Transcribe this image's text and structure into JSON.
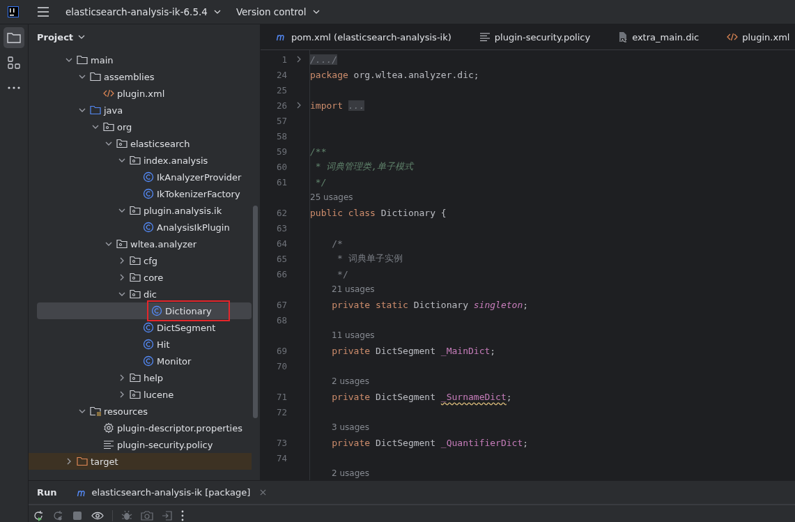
{
  "title_bar": {
    "project": "elasticsearch-analysis-ik-6.5.4",
    "vcs": "Version control"
  },
  "project_panel": {
    "title": "Project"
  },
  "tree": [
    {
      "name": "main",
      "kind": "folder",
      "expanded": true,
      "selected": false,
      "outlined": false,
      "children": [
        {
          "name": "assemblies",
          "kind": "folder",
          "expanded": true,
          "selected": false,
          "outlined": false,
          "children": [
            {
              "name": "plugin.xml",
              "kind": "xml",
              "selected": false,
              "outlined": false
            }
          ]
        },
        {
          "name": "java",
          "kind": "source-folder",
          "expanded": true,
          "selected": false,
          "outlined": false,
          "children": [
            {
              "name": "org",
              "kind": "package",
              "expanded": true,
              "selected": false,
              "outlined": false,
              "children": [
                {
                  "name": "elasticsearch",
                  "kind": "package",
                  "expanded": true,
                  "selected": false,
                  "outlined": false,
                  "children": [
                    {
                      "name": "index.analysis",
                      "kind": "package",
                      "expanded": true,
                      "selected": false,
                      "outlined": false,
                      "children": [
                        {
                          "name": "IkAnalyzerProvider",
                          "kind": "class",
                          "selected": false,
                          "outlined": false
                        },
                        {
                          "name": "IkTokenizerFactory",
                          "kind": "class",
                          "selected": false,
                          "outlined": false
                        }
                      ]
                    },
                    {
                      "name": "plugin.analysis.ik",
                      "kind": "package",
                      "expanded": true,
                      "selected": false,
                      "outlined": false,
                      "children": [
                        {
                          "name": "AnalysisIkPlugin",
                          "kind": "class",
                          "selected": false,
                          "outlined": false
                        }
                      ]
                    }
                  ]
                },
                {
                  "name": "wltea.analyzer",
                  "kind": "package",
                  "expanded": true,
                  "selected": false,
                  "outlined": false,
                  "children": [
                    {
                      "name": "cfg",
                      "kind": "package",
                      "expanded": false,
                      "selected": false,
                      "outlined": false
                    },
                    {
                      "name": "core",
                      "kind": "package",
                      "expanded": false,
                      "selected": false,
                      "outlined": false
                    },
                    {
                      "name": "dic",
                      "kind": "package",
                      "expanded": true,
                      "selected": false,
                      "outlined": false,
                      "children": [
                        {
                          "name": "Dictionary",
                          "kind": "class",
                          "selected": true,
                          "outlined": true
                        },
                        {
                          "name": "DictSegment",
                          "kind": "class",
                          "selected": false,
                          "outlined": false
                        },
                        {
                          "name": "Hit",
                          "kind": "class",
                          "selected": false,
                          "outlined": false
                        },
                        {
                          "name": "Monitor",
                          "kind": "class",
                          "selected": false,
                          "outlined": false
                        }
                      ]
                    },
                    {
                      "name": "help",
                      "kind": "package",
                      "expanded": false,
                      "selected": false,
                      "outlined": false
                    },
                    {
                      "name": "lucene",
                      "kind": "package",
                      "expanded": false,
                      "selected": false,
                      "outlined": false
                    }
                  ]
                }
              ]
            }
          ]
        },
        {
          "name": "resources",
          "kind": "resources-folder",
          "expanded": true,
          "selected": false,
          "outlined": false,
          "children": [
            {
              "name": "plugin-descriptor.properties",
              "kind": "properties",
              "selected": false,
              "outlined": false
            },
            {
              "name": "plugin-security.policy",
              "kind": "policy",
              "selected": false,
              "outlined": false
            }
          ]
        }
      ]
    },
    {
      "name": "target",
      "kind": "excluded-folder",
      "expanded": false,
      "selected": false,
      "outlined": false
    }
  ],
  "tabs": [
    {
      "label": "pom.xml (elasticsearch-analysis-ik)",
      "kind": "maven"
    },
    {
      "label": "plugin-security.policy",
      "kind": "policy"
    },
    {
      "label": "extra_main.dic",
      "kind": "dic"
    },
    {
      "label": "plugin.xml",
      "kind": "xml"
    }
  ],
  "code": [
    {
      "kind": "line",
      "number": "1",
      "fold": true,
      "indent": false,
      "tokens": [
        {
          "kind": "folded",
          "text": "/.../"
        }
      ]
    },
    {
      "kind": "line",
      "number": "24",
      "fold": false,
      "indent": false,
      "tokens": [
        {
          "kind": "keyword",
          "text": "package"
        },
        {
          "kind": "plain",
          "text": " org.wltea.analyzer.dic;"
        }
      ]
    },
    {
      "kind": "line",
      "number": "25",
      "fold": false
    },
    {
      "kind": "line",
      "number": "26",
      "fold": true,
      "indent": false,
      "tokens": [
        {
          "kind": "keyword",
          "text": "import"
        },
        {
          "kind": "folded",
          "text": "..."
        }
      ]
    },
    {
      "kind": "line",
      "number": "57",
      "fold": false
    },
    {
      "kind": "line",
      "number": "58",
      "fold": false
    },
    {
      "kind": "line",
      "number": "59",
      "fold": false,
      "indent": false,
      "tokens": [
        {
          "kind": "doc",
          "text": "/**"
        }
      ]
    },
    {
      "kind": "line",
      "number": "60",
      "fold": false,
      "indent": false,
      "tokens": [
        {
          "kind": "doc",
          "text": " * 词典管理类,单子模式"
        }
      ]
    },
    {
      "kind": "line",
      "number": "61",
      "fold": false,
      "indent": false,
      "tokens": [
        {
          "kind": "doc",
          "text": " */"
        }
      ]
    },
    {
      "kind": "hint",
      "text": "25 usages",
      "indent": false
    },
    {
      "kind": "line",
      "number": "62",
      "fold": false,
      "indent": false,
      "tokens": [
        {
          "kind": "keyword",
          "text": "public class"
        },
        {
          "kind": "plain",
          "text": " Dictionary {"
        }
      ]
    },
    {
      "kind": "line",
      "number": "63",
      "fold": false
    },
    {
      "kind": "line",
      "number": "64",
      "fold": false,
      "indent": true,
      "tokens": [
        {
          "kind": "comment",
          "text": "/*"
        }
      ]
    },
    {
      "kind": "line",
      "number": "65",
      "fold": false,
      "indent": true,
      "tokens": [
        {
          "kind": "comment",
          "text": " * 词典单子实例"
        }
      ]
    },
    {
      "kind": "line",
      "number": "66",
      "fold": false,
      "indent": true,
      "tokens": [
        {
          "kind": "comment",
          "text": " */"
        }
      ]
    },
    {
      "kind": "hint",
      "text": "21 usages",
      "indent": true
    },
    {
      "kind": "line",
      "number": "67",
      "fold": false,
      "indent": true,
      "tokens": [
        {
          "kind": "keyword",
          "text": "private static"
        },
        {
          "kind": "plain",
          "text": " Dictionary "
        },
        {
          "kind": "static-field",
          "text": "singleton"
        },
        {
          "kind": "plain",
          "text": ";"
        }
      ]
    },
    {
      "kind": "line",
      "number": "68",
      "fold": false
    },
    {
      "kind": "hint",
      "text": "11 usages",
      "indent": true
    },
    {
      "kind": "line",
      "number": "69",
      "fold": false,
      "indent": true,
      "tokens": [
        {
          "kind": "keyword",
          "text": "private"
        },
        {
          "kind": "plain",
          "text": " DictSegment "
        },
        {
          "kind": "field",
          "text": "_MainDict"
        },
        {
          "kind": "plain",
          "text": ";"
        }
      ]
    },
    {
      "kind": "line",
      "number": "70",
      "fold": false
    },
    {
      "kind": "hint",
      "text": "2 usages",
      "indent": true
    },
    {
      "kind": "line",
      "number": "71",
      "fold": false,
      "indent": true,
      "tokens": [
        {
          "kind": "keyword",
          "text": "private"
        },
        {
          "kind": "plain",
          "text": " DictSegment "
        },
        {
          "kind": "field-warning",
          "text": "_SurnameDict"
        },
        {
          "kind": "plain",
          "text": ";"
        }
      ]
    },
    {
      "kind": "line",
      "number": "72",
      "fold": false
    },
    {
      "kind": "hint",
      "text": "3 usages",
      "indent": true
    },
    {
      "kind": "line",
      "number": "73",
      "fold": false,
      "indent": true,
      "tokens": [
        {
          "kind": "keyword",
          "text": "private"
        },
        {
          "kind": "plain",
          "text": " DictSegment "
        },
        {
          "kind": "field",
          "text": "_QuantifierDict"
        },
        {
          "kind": "plain",
          "text": ";"
        }
      ]
    },
    {
      "kind": "line",
      "number": "74",
      "fold": false
    },
    {
      "kind": "hint",
      "text": "2 usages",
      "indent": true
    }
  ],
  "run_panel": {
    "title": "Run",
    "tab": "elasticsearch-analysis-ik [package]"
  }
}
